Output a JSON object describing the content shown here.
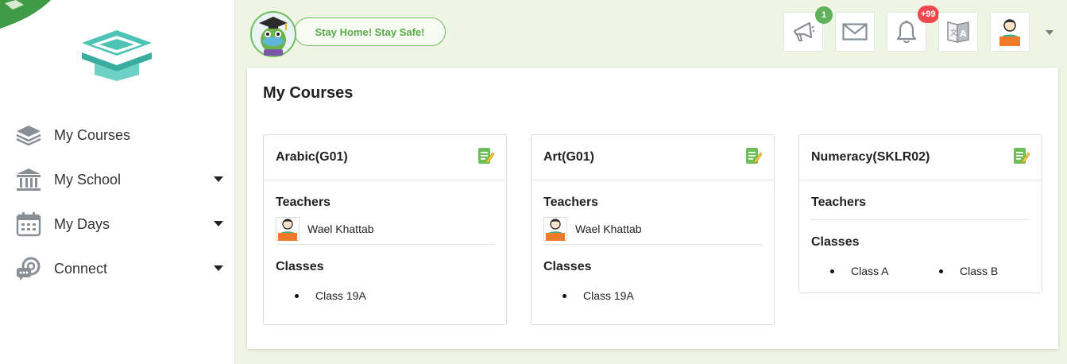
{
  "sidebar": {
    "items": [
      {
        "label": "My Courses",
        "icon": "layers-icon",
        "has_caret": false
      },
      {
        "label": "My School",
        "icon": "school-building-icon",
        "has_caret": true
      },
      {
        "label": "My Days",
        "icon": "calendar-icon",
        "has_caret": true
      },
      {
        "label": "Connect",
        "icon": "chat-connect-icon",
        "has_caret": true
      }
    ]
  },
  "header": {
    "banner_text": "Stay Home! Stay Safe!",
    "announcements_badge": "1",
    "notifications_badge": "+99"
  },
  "main": {
    "title": "My Courses",
    "courses": [
      {
        "title": "Arabic(G01)",
        "teachers_label": "Teachers",
        "teachers": [
          "Wael Khattab"
        ],
        "classes_label": "Classes",
        "classes": [
          "Class 19A"
        ]
      },
      {
        "title": "Art(G01)",
        "teachers_label": "Teachers",
        "teachers": [
          "Wael Khattab"
        ],
        "classes_label": "Classes",
        "classes": [
          "Class 19A"
        ]
      },
      {
        "title": "Numeracy(SKLR02)",
        "teachers_label": "Teachers",
        "teachers": [],
        "classes_label": "Classes",
        "classes": [
          "Class A",
          "Class B"
        ]
      }
    ]
  },
  "colors": {
    "accent_green": "#5fb15a",
    "page_background": "#eef5e3",
    "logo_teal": "#4cc3b5",
    "badge_red": "#f0494d"
  }
}
